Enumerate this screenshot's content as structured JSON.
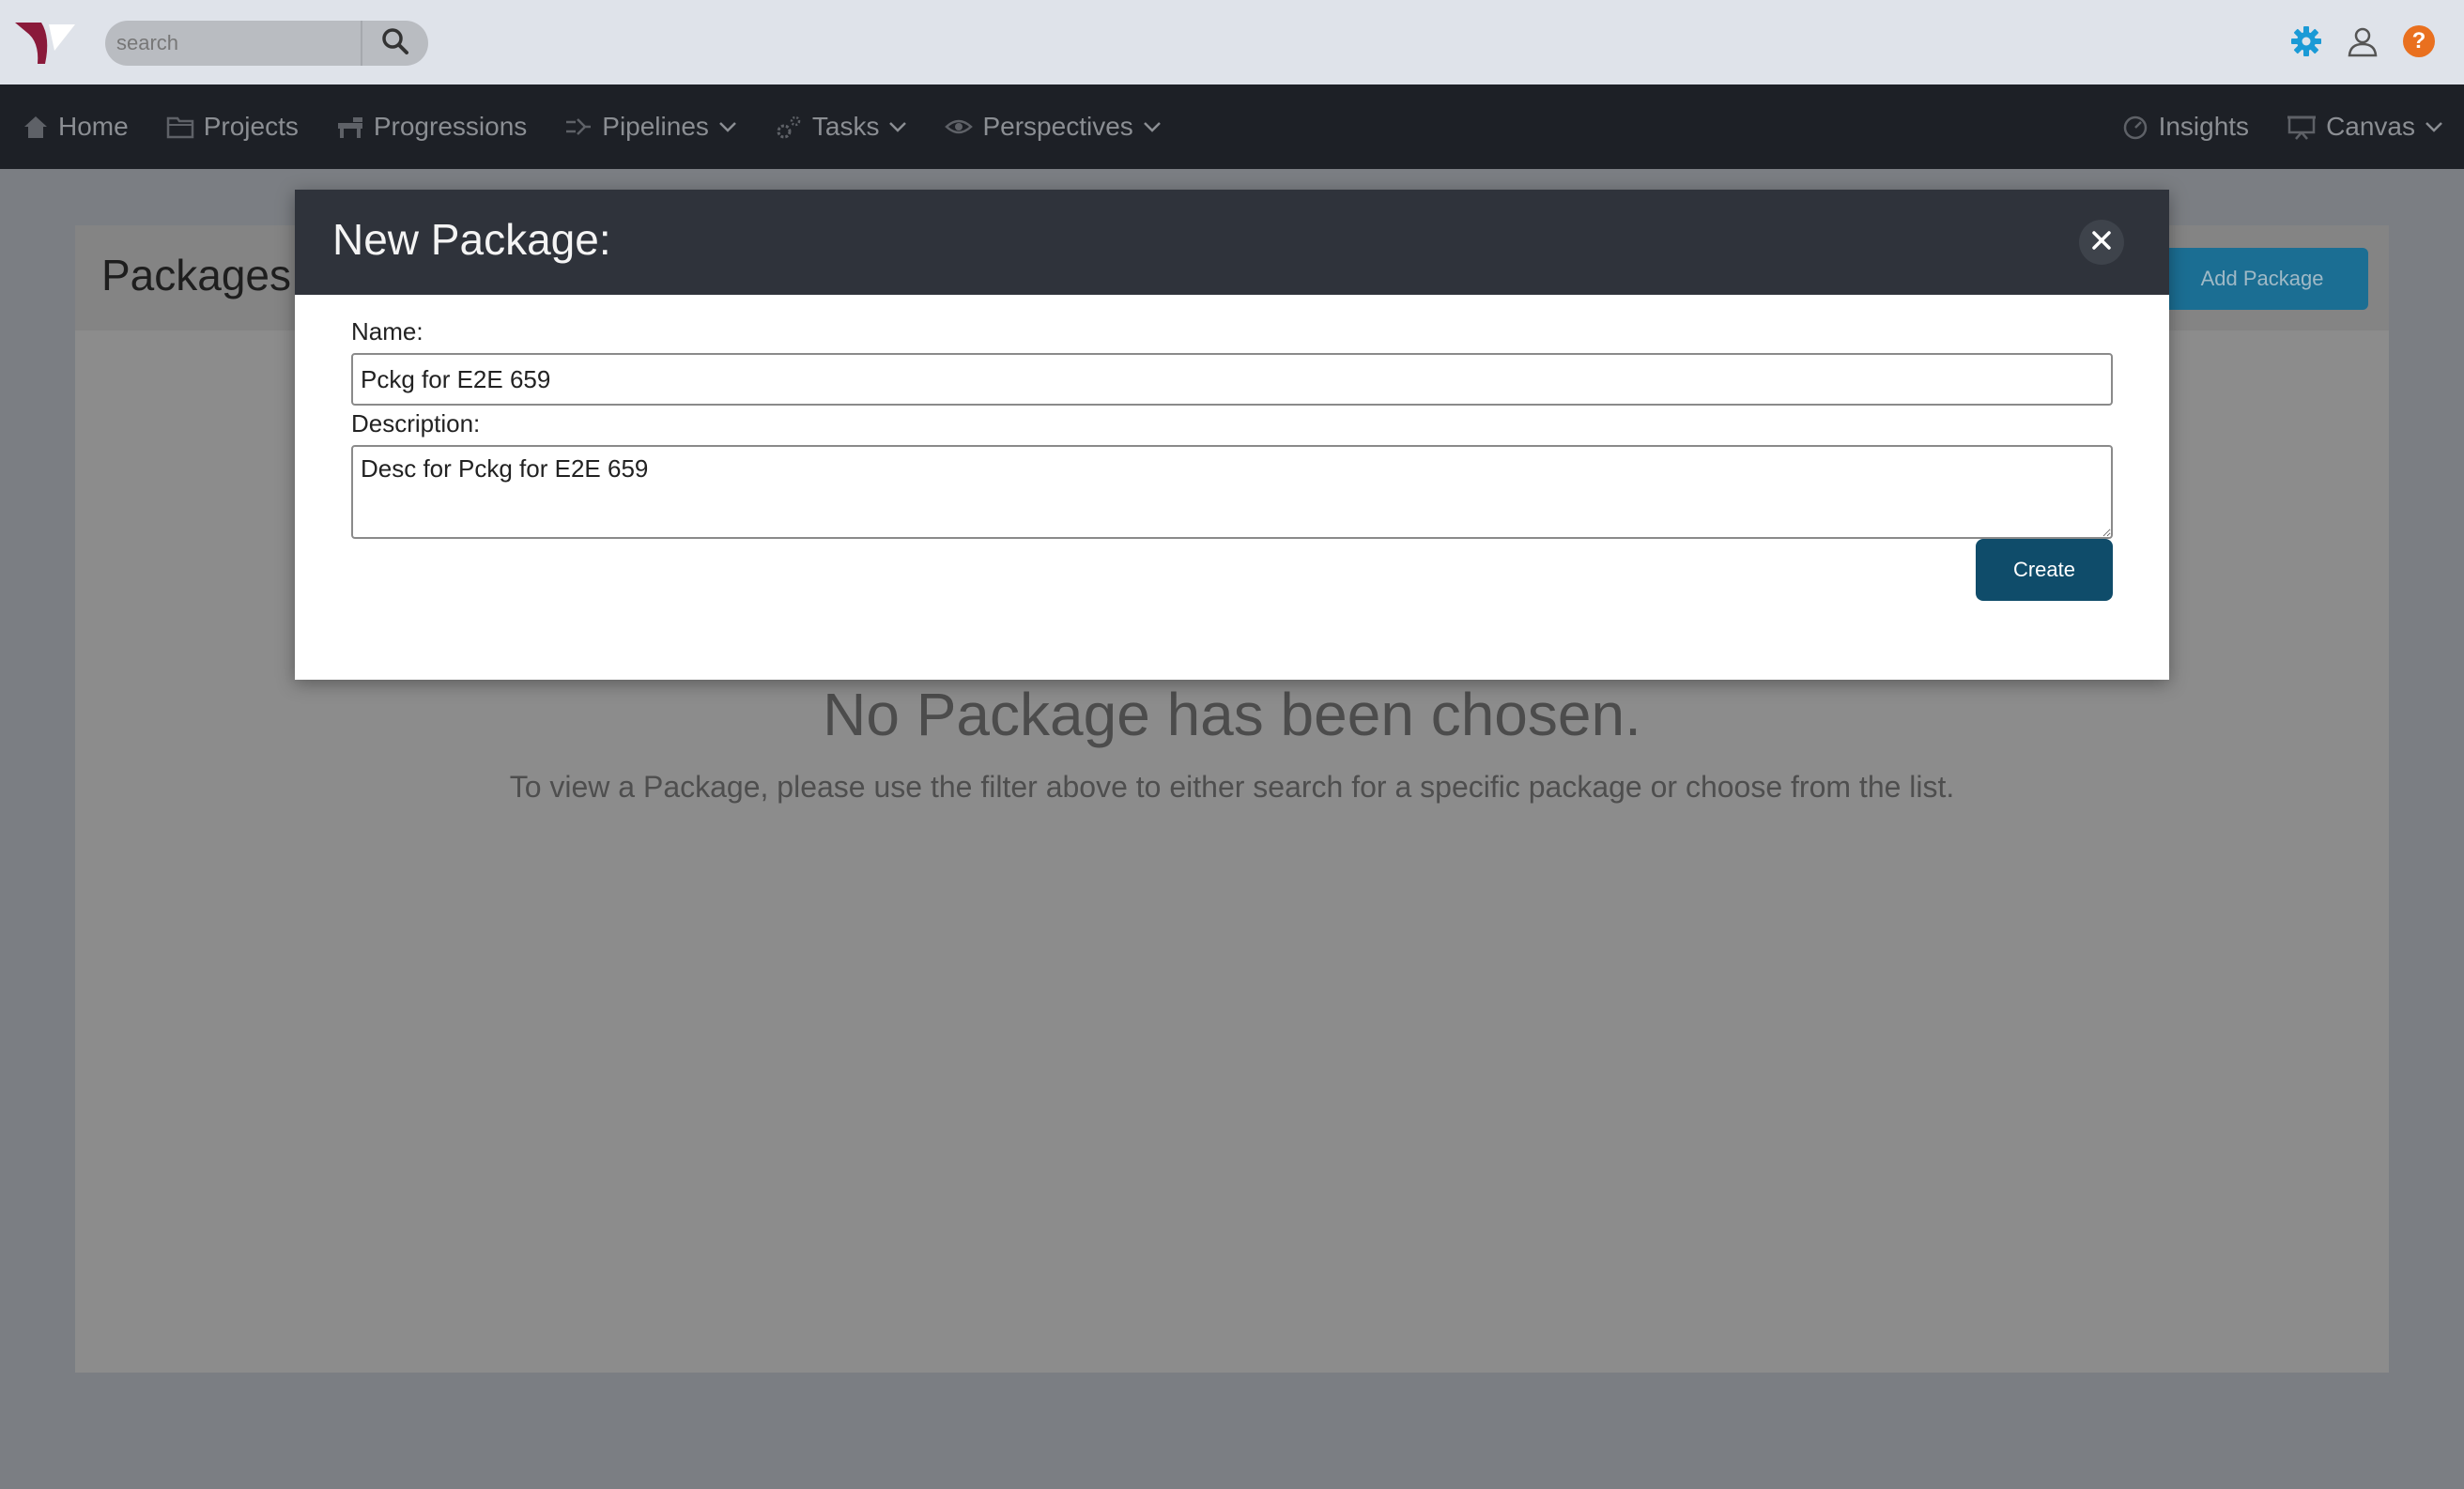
{
  "search": {
    "placeholder": "search"
  },
  "nav": {
    "left": [
      {
        "label": "Home",
        "icon": "home-icon"
      },
      {
        "label": "Projects",
        "icon": "folder-icon"
      },
      {
        "label": "Progressions",
        "icon": "progressions-icon"
      },
      {
        "label": "Pipelines",
        "icon": "pipelines-icon",
        "dropdown": true
      },
      {
        "label": "Tasks",
        "icon": "gears-icon",
        "dropdown": true
      },
      {
        "label": "Perspectives",
        "icon": "eye-icon",
        "dropdown": true
      }
    ],
    "right": [
      {
        "label": "Insights",
        "icon": "gauge-icon"
      },
      {
        "label": "Canvas",
        "icon": "presentation-icon",
        "dropdown": true
      }
    ]
  },
  "panel": {
    "title": "Packages",
    "add_button": "Add Package",
    "empty_title": "No Package has been chosen.",
    "empty_subtitle": "To view a Package, please use the filter above to either search for a specific package or choose from the list."
  },
  "modal": {
    "title": "New Package:",
    "name_label": "Name:",
    "name_value": "Pckg for E2E 659",
    "description_label": "Description:",
    "description_value": "Desc for Pckg for E2E 659",
    "create_button": "Create"
  },
  "colors": {
    "settings_icon": "#1a9ad6",
    "help_icon": "#e9701f",
    "logo": "#8a1a3a",
    "create_button": "#0f4c6a",
    "add_button": "#1b6e93"
  }
}
